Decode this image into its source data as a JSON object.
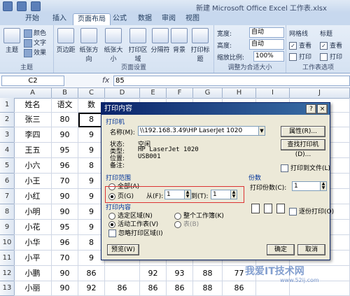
{
  "window": {
    "title": "新建 Microsoft Office Excel 工作表.xlsx"
  },
  "ribbon": {
    "tabs": [
      "开始",
      "插入",
      "页面布局",
      "公式",
      "数据",
      "审阅",
      "视图"
    ],
    "active_tab": "页面布局",
    "theme_group": {
      "label": "主题",
      "theme_btn": "主题",
      "colors": "颜色",
      "fonts": "文字",
      "effects": "效果"
    },
    "page_setup_group": {
      "label": "页面设置",
      "buttons": [
        "页边距",
        "纸张方向",
        "纸张大小",
        "打印区域",
        "分隔符",
        "背景",
        "打印标题"
      ]
    },
    "scale_group": {
      "label": "调整为合适大小",
      "width_label": "宽度:",
      "width_value": "自动",
      "height_label": "高度:",
      "height_value": "自动",
      "scale_label": "缩放比例:",
      "scale_value": "100%"
    },
    "sheet_options_group": {
      "label": "工作表选项",
      "gridlines": "网格线",
      "headings": "标题",
      "view": "查看",
      "print": "打印"
    }
  },
  "formula_bar": {
    "name_box": "C2",
    "fx": "fx",
    "value": "85"
  },
  "grid": {
    "columns": [
      "A",
      "B",
      "C",
      "D",
      "E",
      "F",
      "G",
      "H",
      "I",
      "J"
    ],
    "header_row": [
      "姓名",
      "语文",
      "数学"
    ],
    "rows": [
      {
        "n": "1",
        "cells": [
          "姓名",
          "语文",
          "数"
        ]
      },
      {
        "n": "2",
        "cells": [
          "张三",
          "80",
          "8"
        ]
      },
      {
        "n": "3",
        "cells": [
          "李四",
          "90",
          "9"
        ]
      },
      {
        "n": "4",
        "cells": [
          "王五",
          "95",
          "9"
        ]
      },
      {
        "n": "5",
        "cells": [
          "小六",
          "96",
          "8"
        ]
      },
      {
        "n": "6",
        "cells": [
          "小王",
          "70",
          "9"
        ]
      },
      {
        "n": "7",
        "cells": [
          "小红",
          "90",
          "9"
        ]
      },
      {
        "n": "8",
        "cells": [
          "小明",
          "90",
          "9"
        ]
      },
      {
        "n": "9",
        "cells": [
          "小花",
          "95",
          "9"
        ]
      },
      {
        "n": "10",
        "cells": [
          "小华",
          "96",
          "8"
        ]
      },
      {
        "n": "11",
        "cells": [
          "小平",
          "70",
          "9"
        ]
      },
      {
        "n": "12",
        "cells": [
          "小鹏",
          "90",
          "86",
          "",
          "92",
          "93",
          "88",
          "77",
          ""
        ]
      },
      {
        "n": "13",
        "cells": [
          "小丽",
          "90",
          "92",
          "86",
          "86",
          "86",
          "88",
          "86",
          ""
        ]
      }
    ]
  },
  "dialog": {
    "title": "打印内容",
    "printer_section": "打印机",
    "name_label": "名称(M):",
    "name_value": "\\\\192.168.3.49\\HP LaserJet 1020",
    "properties_btn": "属性(R)...",
    "find_printer_btn": "查找打印机(D)...",
    "status_label": "状态:",
    "status_value": "空闲",
    "type_label": "类型:",
    "type_value": "HP LaserJet 1020",
    "where_label": "位置:",
    "where_value": "USB001",
    "comment_label": "备注:",
    "comment_value": "",
    "print_to_file": "打印到文件(L)",
    "range_section": "打印范围",
    "all_option": "全部(A)",
    "pages_option": "页(G)",
    "from_label": "从(F):",
    "from_value": "1",
    "to_label": "到(T):",
    "to_value": "1",
    "copies_section": "份数",
    "copies_label": "打印份数(C):",
    "copies_value": "1",
    "collate": "逐份打印(O)",
    "content_section": "打印内容",
    "selection": "选定区域(N)",
    "entire_workbook": "整个工作簿(K)",
    "active_sheets": "活动工作表(V)",
    "table": "表(B)",
    "ignore_area": "忽略打印区域(I)",
    "preview_btn": "预览(W)",
    "ok_btn": "确定",
    "cancel_btn": "取消",
    "help_btn": "?",
    "close_btn": "×"
  },
  "watermark": {
    "text": "我爱IT技术网",
    "url": "www.52ij.com"
  }
}
